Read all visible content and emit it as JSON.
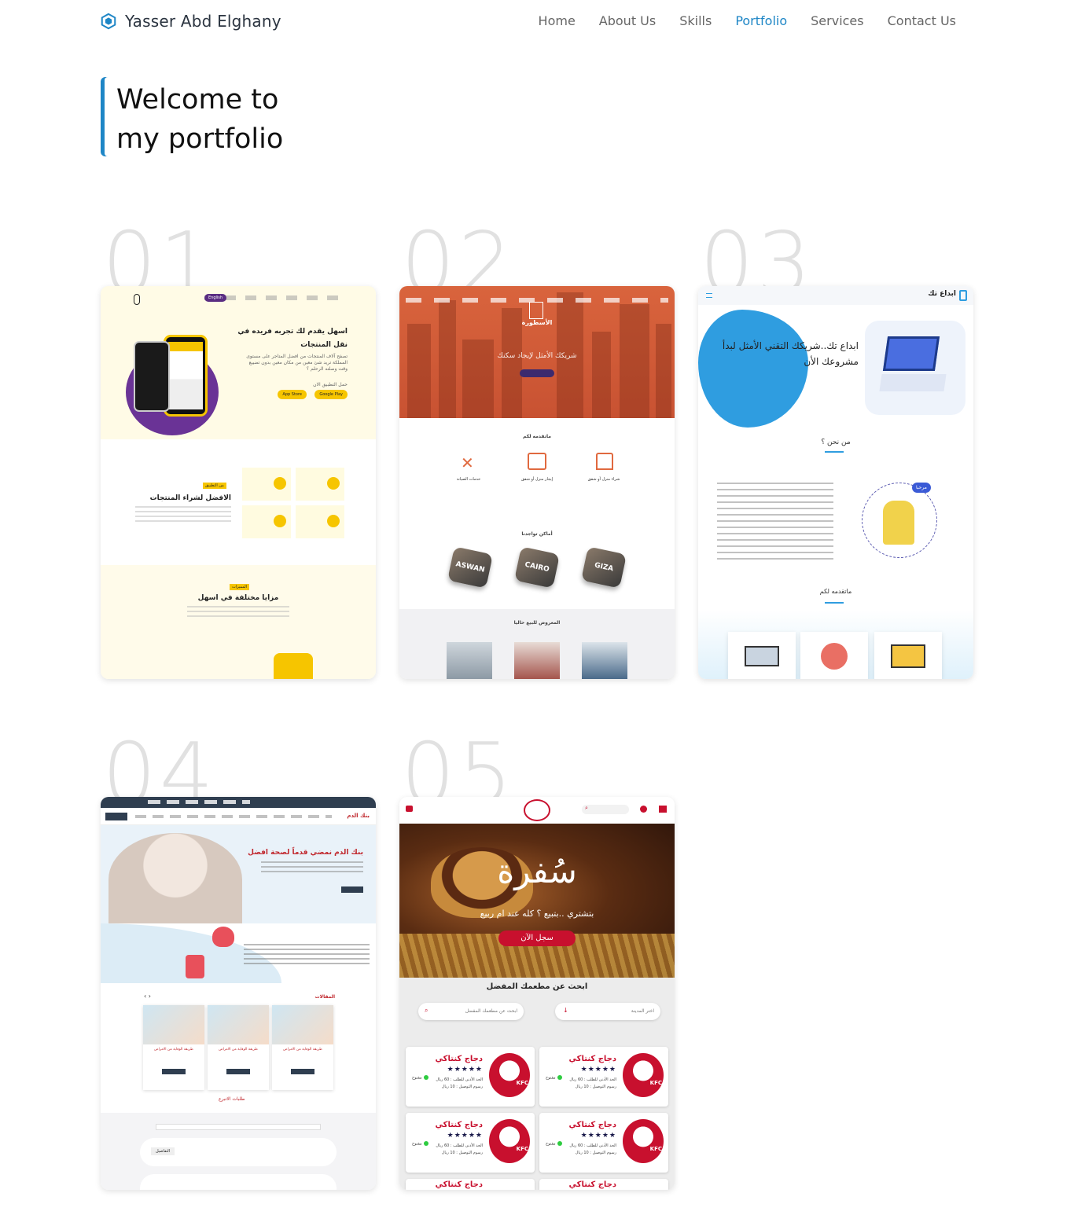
{
  "brand": {
    "name": "Yasser Abd Elghany",
    "accent": "#1e86c6"
  },
  "nav": [
    {
      "label": "Home",
      "active": false
    },
    {
      "label": "About Us",
      "active": false
    },
    {
      "label": "Skills",
      "active": false
    },
    {
      "label": "Portfolio",
      "active": true
    },
    {
      "label": "Services",
      "active": false
    },
    {
      "label": "Contact Us",
      "active": false
    }
  ],
  "hero": {
    "line1": "Welcome to",
    "line2": "my portfolio"
  },
  "projects": [
    {
      "number": "01",
      "hero_title": "اسهل يقدم لك تجربه فريده في نقل المنتجات",
      "hero_text": "تصفح آلاف المنتجات من افضل المتاجر على مستوى المملكة تريد شئ معين من مكان معين بدون تضييع وقت وصلته الرحلم ؟",
      "download_label": "حمل التطبيق الان",
      "appstore": "App Store",
      "googleplay": "Google Play",
      "lang_btn": "English",
      "tag1": "من التطبيق",
      "section2_title": "الافضل لشراء المنتجات",
      "tag2": "المميزات",
      "section3_title": "مزايا مختلفة في اسهل"
    },
    {
      "number": "02",
      "brand": "الأسطورة",
      "hero_text": "شريكك الأمثل لإيجاد سكنك",
      "what_we_offer": "ماتقدمه لكم",
      "services": [
        "خدمات الصيانة",
        "إيجار منزل أو شقق",
        "شراء منزل أو شقق"
      ],
      "places_title": "أماكن تواجدنا",
      "places": [
        "ASWAN",
        "CAIRO",
        "GIZA"
      ],
      "offers_title": "المعروض للبيع حاليا"
    },
    {
      "number": "03",
      "brand": "ابداع تك",
      "hero_title": "ابداع تك..شريكك التقني الأمثل لبدأ مشروعك الأن",
      "about_title": "من نحن ؟",
      "bubble": "مرحبا",
      "services_title": "ماتقدمه لكم"
    },
    {
      "number": "04",
      "brand": "بنك الدم",
      "hero_title": "بنك الدم نمضي قدماً لصحة افضل",
      "articles_title": "المقالات",
      "article_title": "طريقة الوقاية من الامراض",
      "read_more": "المزيد",
      "more_link": "طلبات الاتبرع",
      "details_btn": "التفاصيل"
    },
    {
      "number": "05",
      "brand": "سُفرة",
      "hero_sub": "بتشتري ..بتبيع ؟ كله عند ام ربيع",
      "cta": "سجل الآن",
      "search_title": "ابحث عن مطعمك المفضل",
      "search_placeholder": "ابحث عن مطعمك المفضل",
      "city_placeholder": "اختر المدينة",
      "restaurant_name": "دجاج كنتاكي",
      "stars": "★★★★★",
      "min_order": "الحد الأدنى للطلب : 60 ريال",
      "delivery": "رسوم التوصيل : 10 ريال",
      "status": "مفتوح"
    }
  ]
}
